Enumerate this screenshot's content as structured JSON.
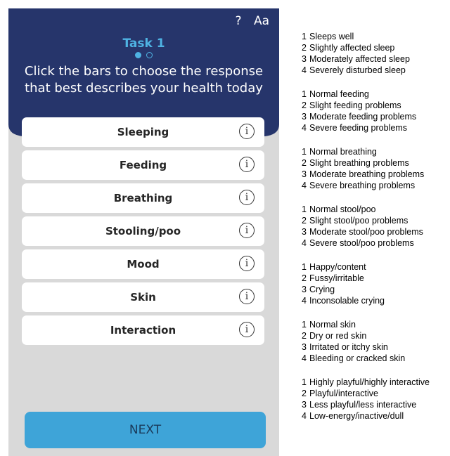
{
  "header": {
    "help_icon": "?",
    "text_size_icon": "Aa",
    "task_title": "Task 1",
    "instruction": "Click the bars to choose the response that best describes your health today",
    "colors": {
      "header_bg": "#26356b",
      "accent": "#4fb3e3"
    },
    "pagination": {
      "total": 2,
      "current": 1
    }
  },
  "bars": [
    {
      "label": "Sleeping",
      "info": "i"
    },
    {
      "label": "Feeding",
      "info": "i"
    },
    {
      "label": "Breathing",
      "info": "i"
    },
    {
      "label": "Stooling/poo",
      "info": "i"
    },
    {
      "label": "Mood",
      "info": "i"
    },
    {
      "label": "Skin",
      "info": "i"
    },
    {
      "label": "Interaction",
      "info": "i"
    }
  ],
  "next_button": {
    "label": "NEXT",
    "color": "#3ea4d8"
  },
  "legend": [
    [
      "Sleeps well",
      "Slightly affected sleep",
      "Moderately affected sleep",
      "Severely disturbed sleep"
    ],
    [
      "Normal feeding",
      "Slight feeding problems",
      "Moderate feeding problems",
      "Severe feeding problems"
    ],
    [
      "Normal breathing",
      "Slight breathing problems",
      "Moderate breathing problems",
      "Severe breathing problems"
    ],
    [
      "Normal stool/poo",
      "Slight stool/poo problems",
      "Moderate stool/poo problems",
      "Severe stool/poo problems"
    ],
    [
      "Happy/content",
      "Fussy/irritable",
      "Crying",
      "Inconsolable crying"
    ],
    [
      "Normal skin",
      "Dry or red skin",
      "Irritated or itchy skin",
      "Bleeding or cracked skin"
    ],
    [
      "Highly playful/highly interactive",
      "Playful/interactive",
      "Less playful/less interactive",
      "Low-energy/inactive/dull"
    ]
  ]
}
